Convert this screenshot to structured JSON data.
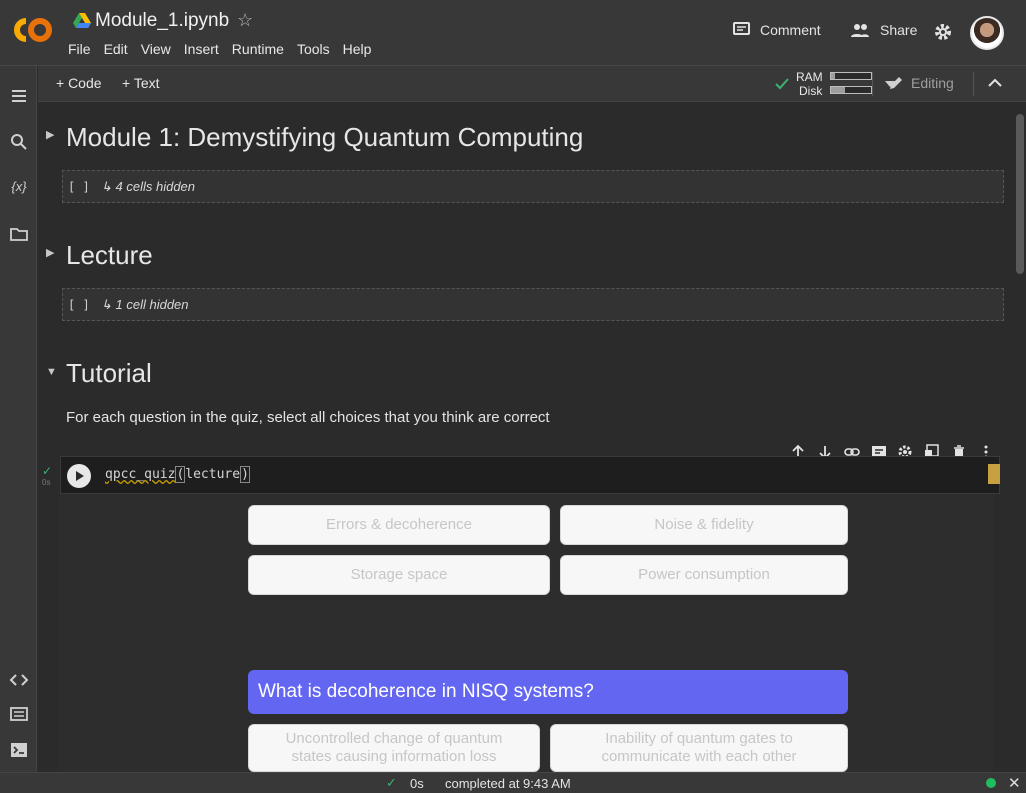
{
  "header": {
    "title": "Module_1.ipynb",
    "menu": [
      "File",
      "Edit",
      "View",
      "Insert",
      "Runtime",
      "Tools",
      "Help"
    ],
    "comment_label": "Comment",
    "share_label": "Share"
  },
  "toolbar": {
    "add_code": "+ Code",
    "add_text": "+ Text",
    "ram_label": "RAM",
    "disk_label": "Disk",
    "ram_fraction": 0.1,
    "disk_fraction": 0.35,
    "editing_label": "Editing"
  },
  "sections": [
    {
      "title": "Module 1: Demystifying Quantum Computing",
      "hidden": "↳ 4 cells hidden",
      "expanded": false
    },
    {
      "title": "Lecture",
      "hidden": "↳ 1 cell hidden",
      "expanded": false
    },
    {
      "title": "Tutorial",
      "expanded": true
    }
  ],
  "tutorial": {
    "instruction": "For each question in the quiz, select all choices that you think are correct",
    "code_fn": "qpcc_quiz",
    "code_arg": "lecture",
    "exec_time": "0s",
    "choices_row1": [
      "Errors & decoherence",
      "Noise & fidelity"
    ],
    "choices_row2": [
      "Storage space",
      "Power consumption"
    ],
    "question": "What is decoherence in NISQ systems?",
    "choices_row3": [
      "Uncontrolled change of quantum states causing information loss",
      "Inability of quantum gates to communicate with each other"
    ]
  },
  "status": {
    "duration": "0s",
    "message": "completed at 9:43 AM"
  },
  "colors": {
    "accent": "#6366f1",
    "brand_orange": "#f9ab00",
    "ok_green": "#1fbf5f"
  }
}
